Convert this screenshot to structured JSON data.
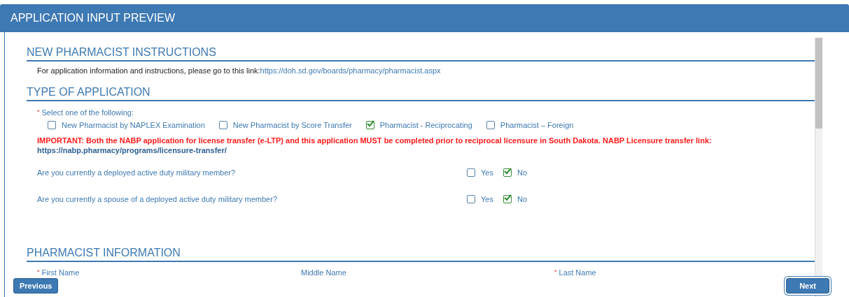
{
  "window": {
    "title": "APPLICATION INPUT PREVIEW"
  },
  "instructions": {
    "heading": "NEW PHARMACIST INSTRUCTIONS",
    "text": "For application information and instructions, please go to this link:",
    "link": "https://doh.sd.gov/boards/pharmacy/pharmacist.aspx"
  },
  "application_type": {
    "heading": "TYPE OF APPLICATION",
    "prompt": "Select one of the following:",
    "required_mark": "*",
    "options": [
      {
        "label": "New Pharmacist by NAPLEX Examination",
        "checked": false
      },
      {
        "label": "New Pharmacist by Score Transfer",
        "checked": false
      },
      {
        "label": "Pharmacist - Reciprocating",
        "checked": true
      },
      {
        "label": "Pharmacist – Foreign",
        "checked": false
      }
    ],
    "notice": "IMPORTANT: Both the NABP application for license transfer (e-LTP) and this application MUST be completed prior to reciprocal licensure in South Dakota. NABP Licensure transfer link:",
    "notice_link": "https://nabp.pharmacy/programs/licensure-transfer/",
    "questions": [
      {
        "text": "Are you currently a deployed active duty military member?",
        "options": [
          {
            "label": "Yes",
            "checked": false
          },
          {
            "label": "No",
            "checked": true
          }
        ]
      },
      {
        "text": "Are you currently a spouse of a deployed active duty military member?",
        "options": [
          {
            "label": "Yes",
            "checked": false
          },
          {
            "label": "No",
            "checked": true
          }
        ]
      }
    ]
  },
  "pharmacist_information": {
    "heading": "PHARMACIST INFORMATION",
    "fields": [
      {
        "label": "First Name",
        "required_mark": "*"
      },
      {
        "label": "Middle Name"
      },
      {
        "label": "Last Name",
        "required_mark": "*"
      }
    ]
  },
  "buttons": [
    "Previous",
    "Next"
  ]
}
